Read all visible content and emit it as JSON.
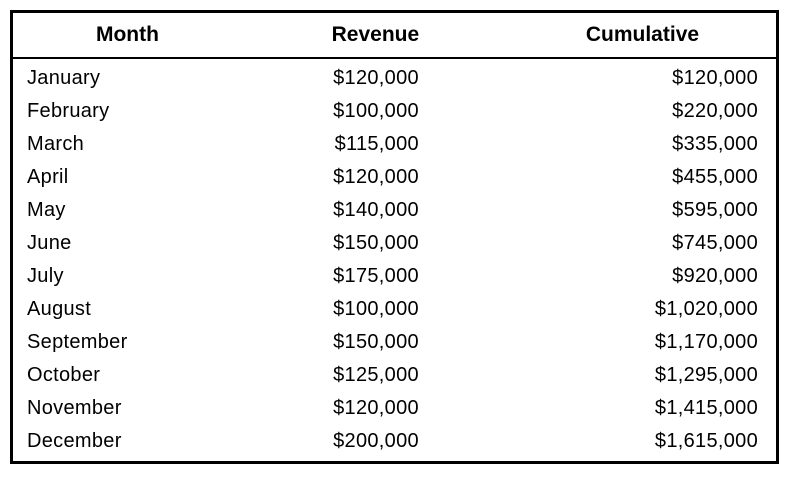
{
  "chart_data": {
    "type": "table",
    "title": "",
    "columns": [
      "Month",
      "Revenue",
      "Cumulative"
    ],
    "rows": [
      {
        "month": "January",
        "revenue": 120000,
        "cumulative": 120000
      },
      {
        "month": "February",
        "revenue": 100000,
        "cumulative": 220000
      },
      {
        "month": "March",
        "revenue": 115000,
        "cumulative": 335000
      },
      {
        "month": "April",
        "revenue": 120000,
        "cumulative": 455000
      },
      {
        "month": "May",
        "revenue": 140000,
        "cumulative": 595000
      },
      {
        "month": "June",
        "revenue": 150000,
        "cumulative": 745000
      },
      {
        "month": "July",
        "revenue": 175000,
        "cumulative": 920000
      },
      {
        "month": "August",
        "revenue": 100000,
        "cumulative": 1020000
      },
      {
        "month": "September",
        "revenue": 150000,
        "cumulative": 1170000
      },
      {
        "month": "October",
        "revenue": 125000,
        "cumulative": 1295000
      },
      {
        "month": "November",
        "revenue": 120000,
        "cumulative": 1415000
      },
      {
        "month": "December",
        "revenue": 200000,
        "cumulative": 1615000
      }
    ]
  },
  "headers": {
    "month": "Month",
    "revenue": "Revenue",
    "cumulative": "Cumulative"
  },
  "display_rows": [
    {
      "month": "January",
      "revenue": "$120,000",
      "cumulative": "$120,000"
    },
    {
      "month": "February",
      "revenue": "$100,000",
      "cumulative": "$220,000"
    },
    {
      "month": "March",
      "revenue": "$115,000",
      "cumulative": "$335,000"
    },
    {
      "month": "April",
      "revenue": "$120,000",
      "cumulative": "$455,000"
    },
    {
      "month": "May",
      "revenue": "$140,000",
      "cumulative": "$595,000"
    },
    {
      "month": "June",
      "revenue": "$150,000",
      "cumulative": "$745,000"
    },
    {
      "month": "July",
      "revenue": "$175,000",
      "cumulative": "$920,000"
    },
    {
      "month": "August",
      "revenue": "$100,000",
      "cumulative": "$1,020,000"
    },
    {
      "month": "September",
      "revenue": "$150,000",
      "cumulative": "$1,170,000"
    },
    {
      "month": "October",
      "revenue": "$125,000",
      "cumulative": "$1,295,000"
    },
    {
      "month": "November",
      "revenue": "$120,000",
      "cumulative": "$1,415,000"
    },
    {
      "month": "December",
      "revenue": "$200,000",
      "cumulative": "$1,615,000"
    }
  ]
}
